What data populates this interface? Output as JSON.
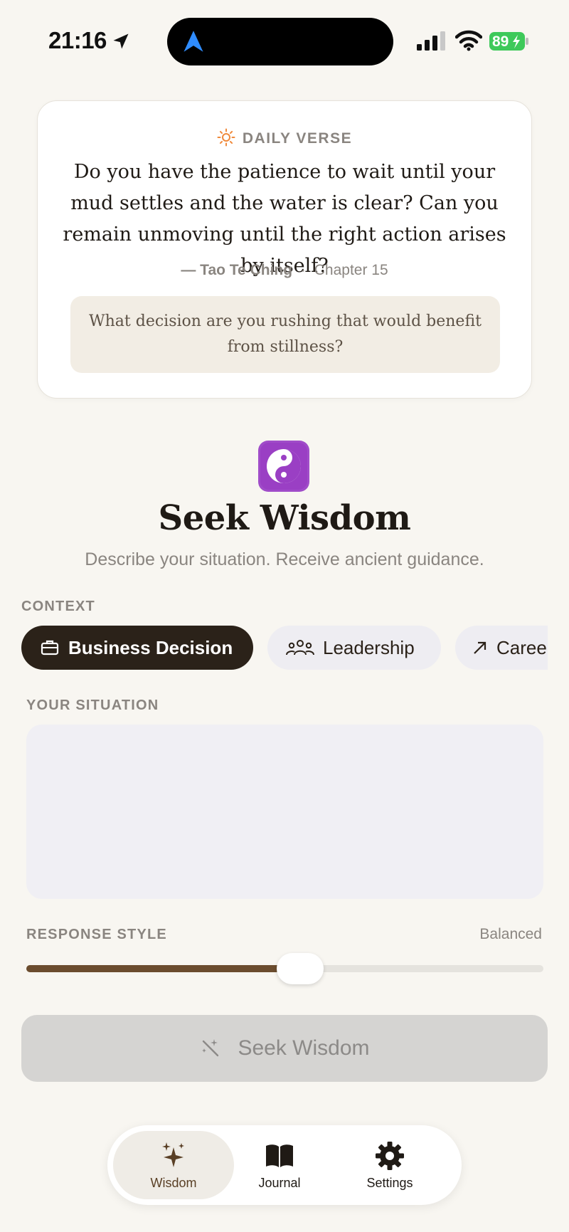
{
  "status_bar": {
    "time": "21:16",
    "battery": "89"
  },
  "daily_verse": {
    "header": "DAILY VERSE",
    "text": "Do you have the patience to wait until your mud settles and the water is clear? Can you remain unmoving until the right action arises by itself?",
    "book": "— Tao Te Ching",
    "separator": "·",
    "chapter": "Chapter 15",
    "reflection": "What decision are you rushing that would benefit from stillness?"
  },
  "hero": {
    "title": "Seek Wisdom",
    "subtitle": "Describe your situation. Receive ancient guidance."
  },
  "context": {
    "label": "CONTEXT",
    "chips": [
      {
        "label": "Business Decision",
        "icon": "briefcase-icon",
        "selected": true
      },
      {
        "label": "Leadership",
        "icon": "people-icon",
        "selected": false
      },
      {
        "label": "Caree",
        "icon": "arrow-up-right-icon",
        "selected": false
      }
    ]
  },
  "situation": {
    "label": "YOUR SITUATION",
    "value": "",
    "placeholder": ""
  },
  "response_style": {
    "label": "RESPONSE STYLE",
    "value_label": "Balanced",
    "level": 0.53
  },
  "seek_button": {
    "label": "Seek Wisdom"
  },
  "tabs": [
    {
      "label": "Wisdom",
      "icon": "sparkles-icon",
      "active": true
    },
    {
      "label": "Journal",
      "icon": "book-icon",
      "active": false
    },
    {
      "label": "Settings",
      "icon": "gear-icon",
      "active": false
    }
  ],
  "colors": {
    "accent": "#2b2219",
    "slider_fill": "#6b4c2e",
    "background": "#f8f6f1",
    "battery": "#3ec95a"
  }
}
